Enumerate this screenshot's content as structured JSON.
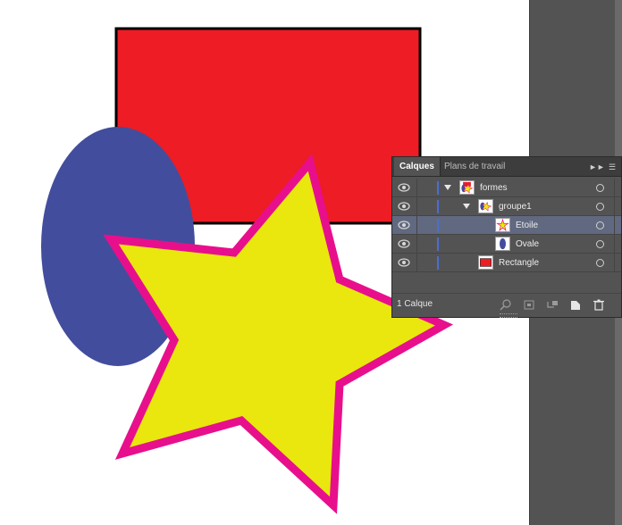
{
  "colors": {
    "rectangle_fill": "#ee1c24",
    "ellipse_fill": "#434d9d",
    "star_fill": "#e9e70e",
    "star_stroke": "#e80f8c",
    "layer_color_bar": "#4a6fd0"
  },
  "panel": {
    "tabs": [
      "Calques",
      "Plans de travail"
    ],
    "layers": [
      {
        "name": "formes",
        "expanded": true
      },
      {
        "name": "groupe1",
        "expanded": true
      },
      {
        "name": "Etoile",
        "selected": true
      },
      {
        "name": "Ovale"
      },
      {
        "name": "Rectangle"
      }
    ],
    "footer_label": "1 Calque"
  }
}
